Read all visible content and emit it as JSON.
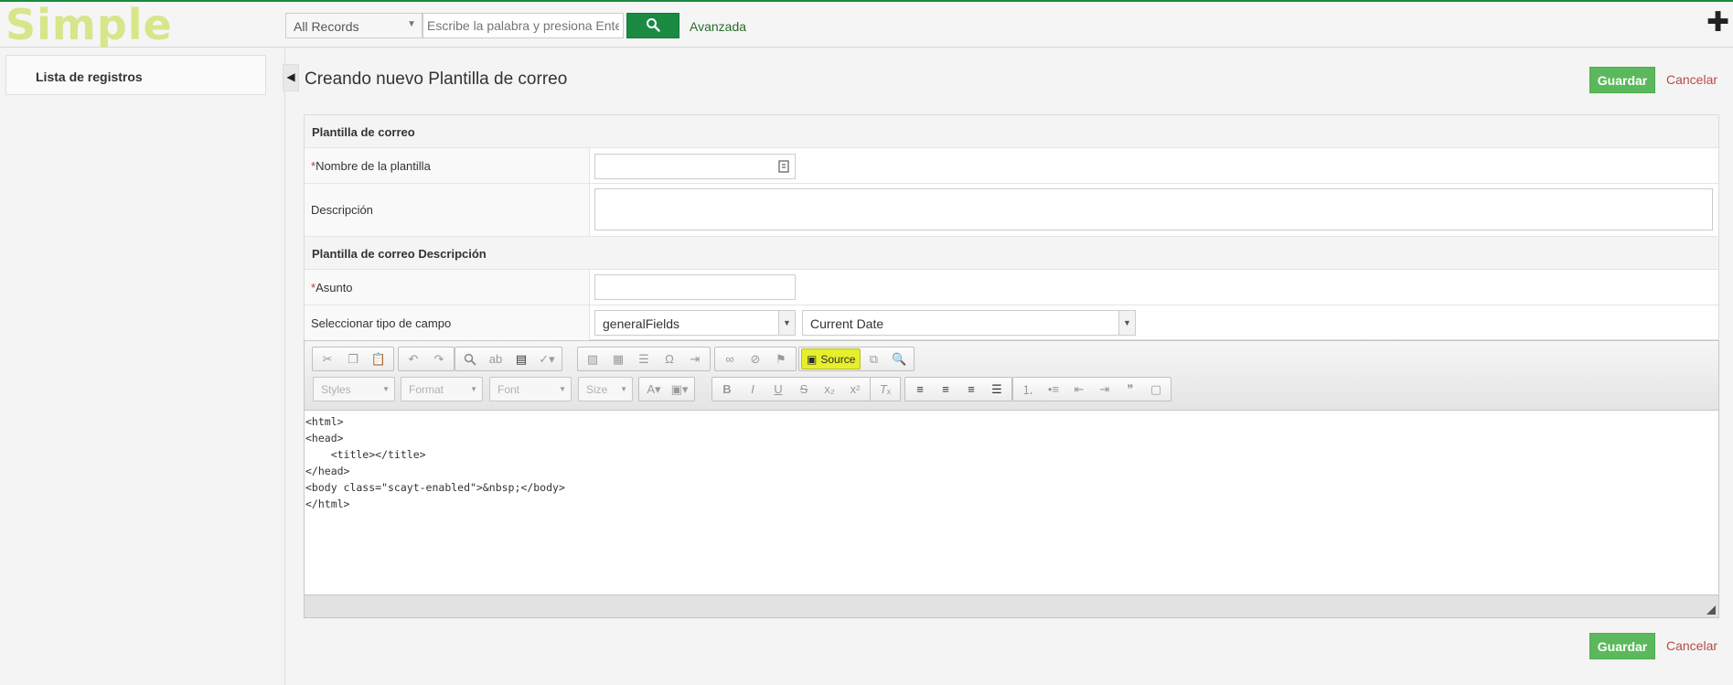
{
  "header": {
    "logo": "Simple",
    "module_select": "All Records",
    "search_placeholder": "Escribe la palabra y presiona Enter",
    "advanced_label": "Avanzada"
  },
  "sidebar": {
    "items": [
      {
        "label": "Lista de registros"
      }
    ]
  },
  "page": {
    "title": "Creando nuevo Plantilla de correo",
    "save_label": "Guardar",
    "cancel_label": "Cancelar"
  },
  "form": {
    "section1_title": "Plantilla de correo",
    "template_name_label": "Nombre de la plantilla",
    "description_label": "Descripción",
    "section2_title": "Plantilla de correo Descripción",
    "subject_label": "Asunto",
    "field_type_label": "Seleccionar tipo de campo",
    "field_type_select": "generalFields",
    "field_select": "Current Date",
    "required_mark": "*"
  },
  "editor": {
    "source_label": "Source",
    "combos": {
      "styles": "Styles",
      "format": "Format",
      "font": "Font",
      "size": "Size"
    },
    "source_code": "<html>\n<head>\n    <title></title>\n</head>\n<body class=\"scayt-enabled\">&nbsp;</body>\n</html>"
  }
}
